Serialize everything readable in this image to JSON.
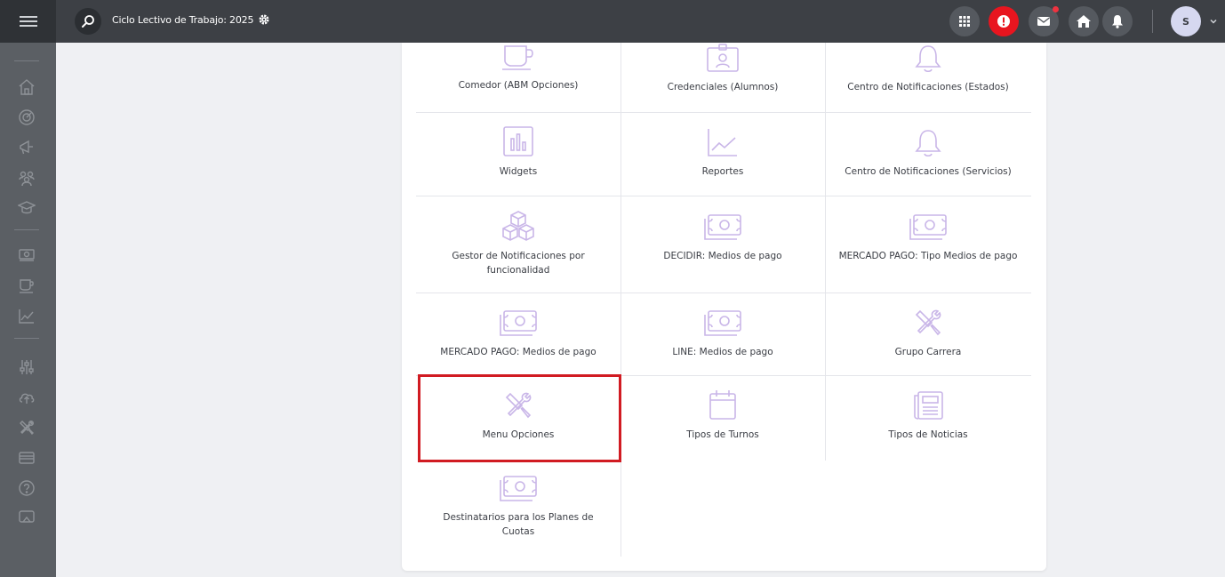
{
  "topbar": {
    "cycle_title": "Ciclo Lectivo de Trabajo: 2025",
    "avatar_initial": "S"
  },
  "colors": {
    "topbar": "#3d4045",
    "sidebar": "#5b5f64",
    "alert": "#e8151f",
    "icon_lilac": "#c9b6e8",
    "highlight": "#d11b22"
  },
  "options": [
    {
      "label": "Comedor (ABM Opciones)",
      "icon": "cup-icon"
    },
    {
      "label": "Credenciales (Alumnos)",
      "icon": "id-badge-icon"
    },
    {
      "label": "Centro de Notificaciones (Estados)",
      "icon": "bell-icon"
    },
    {
      "label": "Widgets",
      "icon": "bar-chart-icon"
    },
    {
      "label": "Reportes",
      "icon": "line-chart-icon"
    },
    {
      "label": "Centro de Notificaciones (Servicios)",
      "icon": "bell-icon"
    },
    {
      "label": "Gestor de Notificaciones por funcionalidad",
      "icon": "boxes-icon"
    },
    {
      "label": "DECIDIR: Medios de pago",
      "icon": "money-icon"
    },
    {
      "label": "MERCADO PAGO: Tipo Medios de pago",
      "icon": "money-icon"
    },
    {
      "label": "MERCADO PAGO: Medios de pago",
      "icon": "money-icon"
    },
    {
      "label": "LINE: Medios de pago",
      "icon": "money-icon"
    },
    {
      "label": "Grupo Carrera",
      "icon": "tools-icon"
    },
    {
      "label": "Menu Opciones",
      "icon": "tools-icon"
    },
    {
      "label": "Tipos de Turnos",
      "icon": "calendar-icon"
    },
    {
      "label": "Tipos de Noticias",
      "icon": "newspaper-icon"
    },
    {
      "label": "Destinatarios para los Planes de Cuotas",
      "icon": "money-icon"
    }
  ]
}
